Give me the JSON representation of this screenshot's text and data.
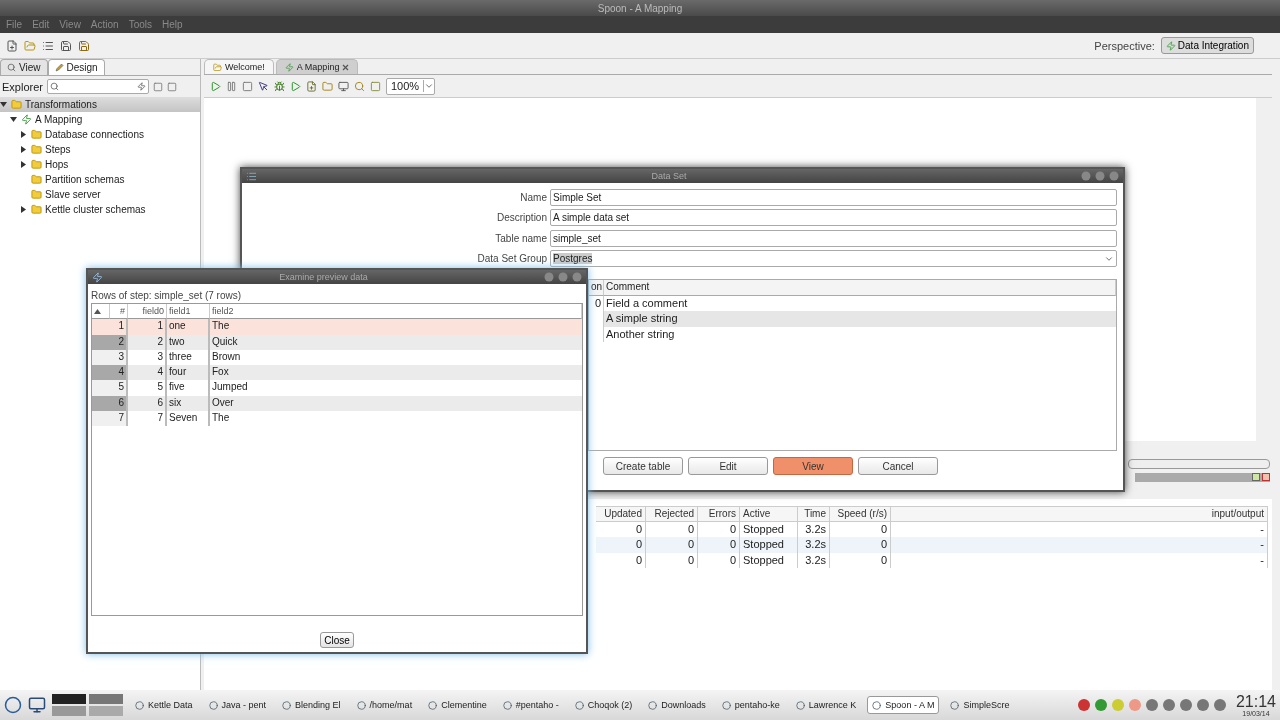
{
  "window": {
    "title": "Spoon - A Mapping"
  },
  "menu": [
    "File",
    "Edit",
    "View",
    "Action",
    "Tools",
    "Help"
  ],
  "perspective": {
    "label": "Perspective:",
    "button": "Data Integration"
  },
  "left_tabs": [
    {
      "label": "View",
      "selected": true
    },
    {
      "label": "Design",
      "selected": false
    }
  ],
  "explorer": {
    "label": "Explorer"
  },
  "tree": [
    {
      "label": "Transformations",
      "kind": "folder",
      "expanded": true,
      "selected": true,
      "children": [
        {
          "label": "A Mapping",
          "kind": "mapping",
          "expanded": true,
          "selected": false,
          "children": [
            {
              "label": "Database connections",
              "kind": "folder",
              "expanded": false,
              "selected": false
            },
            {
              "label": "Steps",
              "kind": "folder",
              "expanded": false,
              "selected": false
            },
            {
              "label": "Hops",
              "kind": "folder",
              "expanded": false,
              "selected": false
            },
            {
              "label": "Partition schemas",
              "kind": "folder",
              "selected": false
            },
            {
              "label": "Slave server",
              "kind": "folder",
              "selected": false
            },
            {
              "label": "Kettle cluster schemas",
              "kind": "folder",
              "expanded": false,
              "selected": false
            }
          ]
        }
      ]
    }
  ],
  "editor_tabs": [
    {
      "label": "Welcome!",
      "selected": false
    },
    {
      "label": "A Mapping",
      "selected": true
    }
  ],
  "zoom": "100%",
  "results": {
    "columns": [
      "Updated",
      "Rejected",
      "Errors",
      "Active",
      "Time",
      "Speed (r/s)",
      "input/output"
    ],
    "rows": [
      [
        "0",
        "0",
        "0",
        "Stopped",
        "3.2s",
        "0",
        "-"
      ],
      [
        "0",
        "0",
        "0",
        "Stopped",
        "3.2s",
        "0",
        "-"
      ],
      [
        "0",
        "0",
        "0",
        "Stopped",
        "3.2s",
        "0",
        "-"
      ]
    ]
  },
  "data_set_dialog": {
    "title": "Data Set",
    "fields": [
      {
        "label": "Name",
        "value": "Simple Set",
        "kind": "text"
      },
      {
        "label": "Description",
        "value": "A simple data set",
        "kind": "text"
      },
      {
        "label": "Table name",
        "value": "simple_set",
        "kind": "text"
      },
      {
        "label": "Data Set Group",
        "value": "Postgres",
        "kind": "dropdown"
      }
    ],
    "grid": {
      "columns": [
        "on",
        "Comment"
      ],
      "rows": [
        {
          "column_1": "0",
          "comment": "Field a comment",
          "selected": false
        },
        {
          "comment": "A simple string",
          "selected": true
        },
        {
          "comment": "Another string",
          "selected": false
        }
      ]
    },
    "buttons": [
      {
        "label": "Create table",
        "primary": false
      },
      {
        "label": "Edit",
        "primary": false
      },
      {
        "label": "View",
        "primary": true
      },
      {
        "label": "Cancel",
        "primary": false
      }
    ]
  },
  "preview_dialog": {
    "title": "Examine preview data",
    "caption": "Rows of step: simple_set (7 rows)",
    "columns": [
      "#",
      "field0",
      "field1",
      "field2"
    ],
    "rows": [
      {
        "cells": [
          "1",
          "1",
          "one",
          "The"
        ],
        "selected": true
      },
      {
        "cells": [
          "2",
          "2",
          "two",
          "Quick"
        ],
        "selected": false
      },
      {
        "cells": [
          "3",
          "3",
          "three",
          "Brown"
        ],
        "selected": false
      },
      {
        "cells": [
          "4",
          "4",
          "four",
          "Fox"
        ],
        "selected": false
      },
      {
        "cells": [
          "5",
          "5",
          "five",
          "Jumped"
        ],
        "selected": false
      },
      {
        "cells": [
          "6",
          "6",
          "six",
          "Over"
        ],
        "selected": false
      },
      {
        "cells": [
          "7",
          "7",
          "Seven",
          "The"
        ],
        "selected": false
      }
    ],
    "close": "Close"
  },
  "taskbar": {
    "tasks": [
      {
        "label": "Kettle Data",
        "selected": false
      },
      {
        "label": "Java - pent",
        "selected": false
      },
      {
        "label": "Blending El",
        "selected": false
      },
      {
        "label": "/home/mat",
        "selected": false
      },
      {
        "label": "Clementine",
        "selected": false
      },
      {
        "label": "#pentaho -",
        "selected": false
      },
      {
        "label": "Choqok (2)",
        "selected": false
      },
      {
        "label": "Downloads",
        "selected": false
      },
      {
        "label": "pentaho-ke",
        "selected": false
      },
      {
        "label": "Lawrence K",
        "selected": false
      },
      {
        "label": "Spoon - A M",
        "selected": true
      },
      {
        "label": "SimpleScre",
        "selected": false
      }
    ],
    "clock": {
      "time": "21:14",
      "date": "19/03/14"
    }
  }
}
